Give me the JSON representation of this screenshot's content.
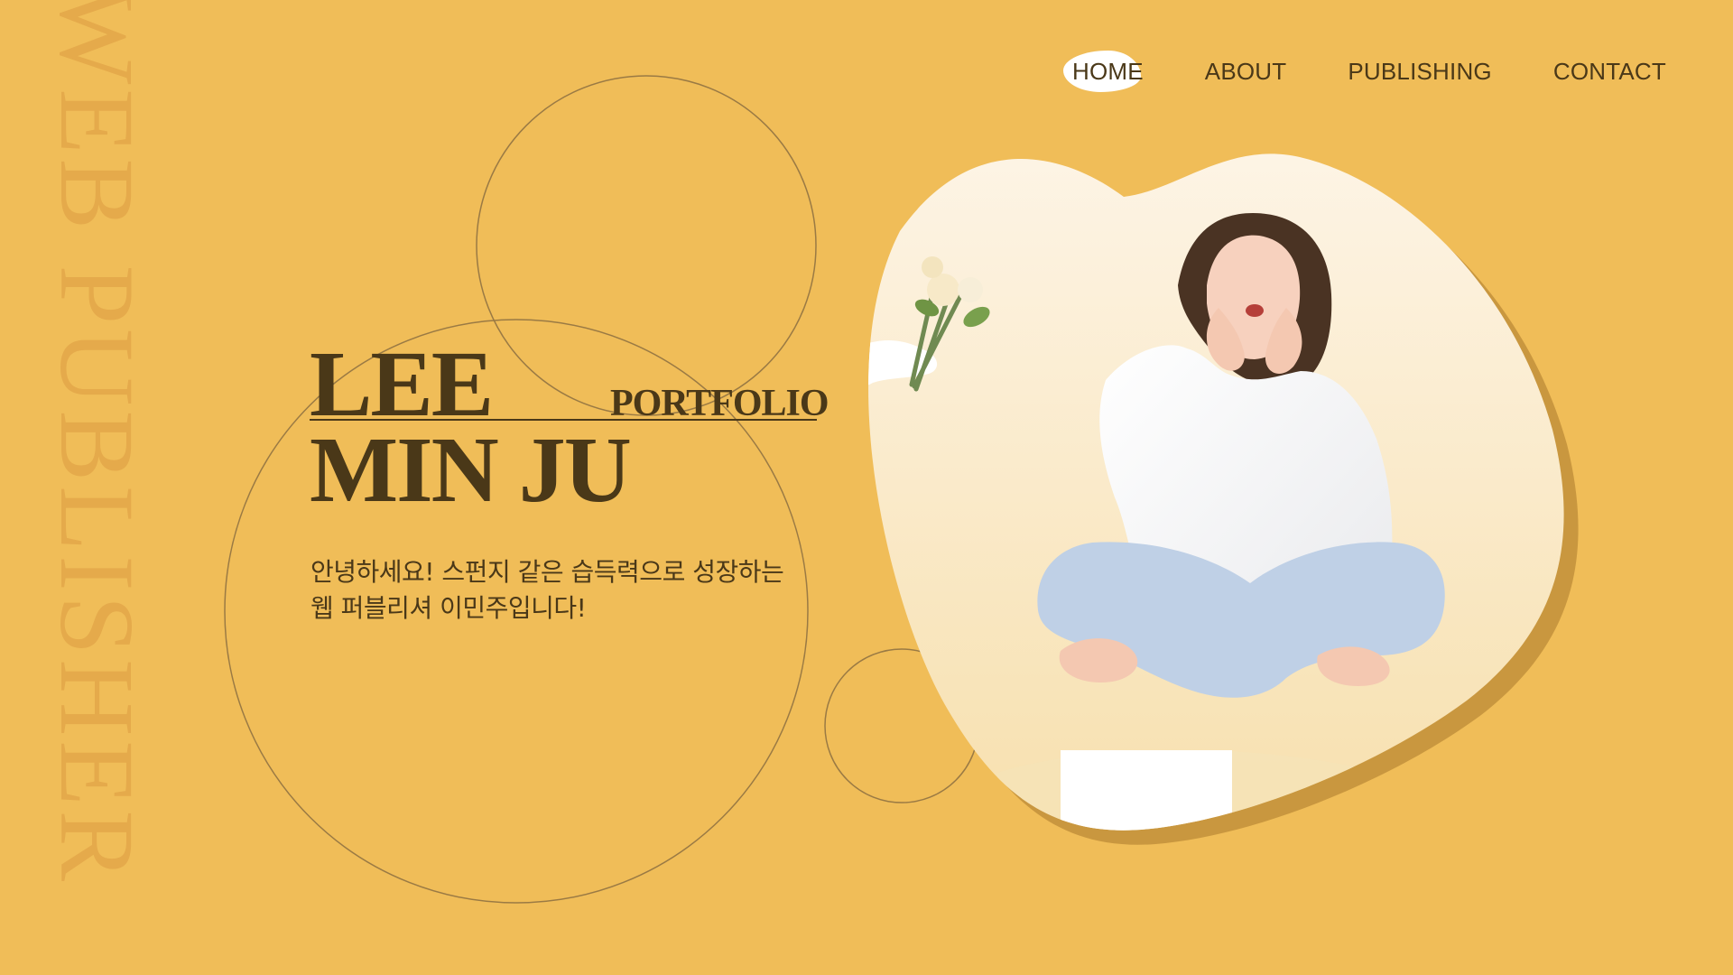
{
  "side_text": "WEB PUBLISHER",
  "nav": {
    "home": "HOME",
    "about": "ABOUT",
    "publishing": "PUBLISHING",
    "contact": "CONTACT"
  },
  "hero": {
    "first_name": "LEE",
    "last_name": "MIN JU",
    "subtitle": "PORTFOLIO"
  },
  "intro": {
    "line1": "안녕하세요! 스펀지 같은 습득력으로 성장하는",
    "line2": "웹 퍼블리셔 이민주입니다!"
  },
  "colors": {
    "background": "#F0BD58",
    "text": "#4A3818",
    "accent_shadow": "#C9973F",
    "photo_backdrop": "#FCF1DB"
  }
}
